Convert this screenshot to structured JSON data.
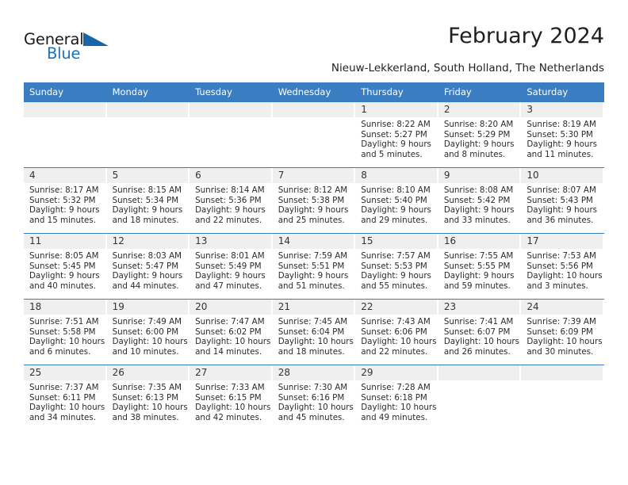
{
  "brand": {
    "name_top": "General",
    "name_bottom": "Blue",
    "accent_color": "#1a74bb",
    "triangle_color": "#1565a8"
  },
  "header": {
    "title": "February 2024",
    "subtitle": "Nieuw-Lekkerland, South Holland, The Netherlands"
  },
  "calendar": {
    "header_bg": "#3a7dc0",
    "daynum_bg": "#efefef",
    "weekday_headers": [
      "Sunday",
      "Monday",
      "Tuesday",
      "Wednesday",
      "Thursday",
      "Friday",
      "Saturday"
    ],
    "weeks": [
      [
        {
          "day": "",
          "sunrise": "",
          "sunset": "",
          "daylight_line1": "",
          "daylight_line2": ""
        },
        {
          "day": "",
          "sunrise": "",
          "sunset": "",
          "daylight_line1": "",
          "daylight_line2": ""
        },
        {
          "day": "",
          "sunrise": "",
          "sunset": "",
          "daylight_line1": "",
          "daylight_line2": ""
        },
        {
          "day": "",
          "sunrise": "",
          "sunset": "",
          "daylight_line1": "",
          "daylight_line2": ""
        },
        {
          "day": "1",
          "sunrise": "Sunrise: 8:22 AM",
          "sunset": "Sunset: 5:27 PM",
          "daylight_line1": "Daylight: 9 hours",
          "daylight_line2": "and 5 minutes."
        },
        {
          "day": "2",
          "sunrise": "Sunrise: 8:20 AM",
          "sunset": "Sunset: 5:29 PM",
          "daylight_line1": "Daylight: 9 hours",
          "daylight_line2": "and 8 minutes."
        },
        {
          "day": "3",
          "sunrise": "Sunrise: 8:19 AM",
          "sunset": "Sunset: 5:30 PM",
          "daylight_line1": "Daylight: 9 hours",
          "daylight_line2": "and 11 minutes."
        }
      ],
      [
        {
          "day": "4",
          "sunrise": "Sunrise: 8:17 AM",
          "sunset": "Sunset: 5:32 PM",
          "daylight_line1": "Daylight: 9 hours",
          "daylight_line2": "and 15 minutes."
        },
        {
          "day": "5",
          "sunrise": "Sunrise: 8:15 AM",
          "sunset": "Sunset: 5:34 PM",
          "daylight_line1": "Daylight: 9 hours",
          "daylight_line2": "and 18 minutes."
        },
        {
          "day": "6",
          "sunrise": "Sunrise: 8:14 AM",
          "sunset": "Sunset: 5:36 PM",
          "daylight_line1": "Daylight: 9 hours",
          "daylight_line2": "and 22 minutes."
        },
        {
          "day": "7",
          "sunrise": "Sunrise: 8:12 AM",
          "sunset": "Sunset: 5:38 PM",
          "daylight_line1": "Daylight: 9 hours",
          "daylight_line2": "and 25 minutes."
        },
        {
          "day": "8",
          "sunrise": "Sunrise: 8:10 AM",
          "sunset": "Sunset: 5:40 PM",
          "daylight_line1": "Daylight: 9 hours",
          "daylight_line2": "and 29 minutes."
        },
        {
          "day": "9",
          "sunrise": "Sunrise: 8:08 AM",
          "sunset": "Sunset: 5:42 PM",
          "daylight_line1": "Daylight: 9 hours",
          "daylight_line2": "and 33 minutes."
        },
        {
          "day": "10",
          "sunrise": "Sunrise: 8:07 AM",
          "sunset": "Sunset: 5:43 PM",
          "daylight_line1": "Daylight: 9 hours",
          "daylight_line2": "and 36 minutes."
        }
      ],
      [
        {
          "day": "11",
          "sunrise": "Sunrise: 8:05 AM",
          "sunset": "Sunset: 5:45 PM",
          "daylight_line1": "Daylight: 9 hours",
          "daylight_line2": "and 40 minutes."
        },
        {
          "day": "12",
          "sunrise": "Sunrise: 8:03 AM",
          "sunset": "Sunset: 5:47 PM",
          "daylight_line1": "Daylight: 9 hours",
          "daylight_line2": "and 44 minutes."
        },
        {
          "day": "13",
          "sunrise": "Sunrise: 8:01 AM",
          "sunset": "Sunset: 5:49 PM",
          "daylight_line1": "Daylight: 9 hours",
          "daylight_line2": "and 47 minutes."
        },
        {
          "day": "14",
          "sunrise": "Sunrise: 7:59 AM",
          "sunset": "Sunset: 5:51 PM",
          "daylight_line1": "Daylight: 9 hours",
          "daylight_line2": "and 51 minutes."
        },
        {
          "day": "15",
          "sunrise": "Sunrise: 7:57 AM",
          "sunset": "Sunset: 5:53 PM",
          "daylight_line1": "Daylight: 9 hours",
          "daylight_line2": "and 55 minutes."
        },
        {
          "day": "16",
          "sunrise": "Sunrise: 7:55 AM",
          "sunset": "Sunset: 5:55 PM",
          "daylight_line1": "Daylight: 9 hours",
          "daylight_line2": "and 59 minutes."
        },
        {
          "day": "17",
          "sunrise": "Sunrise: 7:53 AM",
          "sunset": "Sunset: 5:56 PM",
          "daylight_line1": "Daylight: 10 hours",
          "daylight_line2": "and 3 minutes."
        }
      ],
      [
        {
          "day": "18",
          "sunrise": "Sunrise: 7:51 AM",
          "sunset": "Sunset: 5:58 PM",
          "daylight_line1": "Daylight: 10 hours",
          "daylight_line2": "and 6 minutes."
        },
        {
          "day": "19",
          "sunrise": "Sunrise: 7:49 AM",
          "sunset": "Sunset: 6:00 PM",
          "daylight_line1": "Daylight: 10 hours",
          "daylight_line2": "and 10 minutes."
        },
        {
          "day": "20",
          "sunrise": "Sunrise: 7:47 AM",
          "sunset": "Sunset: 6:02 PM",
          "daylight_line1": "Daylight: 10 hours",
          "daylight_line2": "and 14 minutes."
        },
        {
          "day": "21",
          "sunrise": "Sunrise: 7:45 AM",
          "sunset": "Sunset: 6:04 PM",
          "daylight_line1": "Daylight: 10 hours",
          "daylight_line2": "and 18 minutes."
        },
        {
          "day": "22",
          "sunrise": "Sunrise: 7:43 AM",
          "sunset": "Sunset: 6:06 PM",
          "daylight_line1": "Daylight: 10 hours",
          "daylight_line2": "and 22 minutes."
        },
        {
          "day": "23",
          "sunrise": "Sunrise: 7:41 AM",
          "sunset": "Sunset: 6:07 PM",
          "daylight_line1": "Daylight: 10 hours",
          "daylight_line2": "and 26 minutes."
        },
        {
          "day": "24",
          "sunrise": "Sunrise: 7:39 AM",
          "sunset": "Sunset: 6:09 PM",
          "daylight_line1": "Daylight: 10 hours",
          "daylight_line2": "and 30 minutes."
        }
      ],
      [
        {
          "day": "25",
          "sunrise": "Sunrise: 7:37 AM",
          "sunset": "Sunset: 6:11 PM",
          "daylight_line1": "Daylight: 10 hours",
          "daylight_line2": "and 34 minutes."
        },
        {
          "day": "26",
          "sunrise": "Sunrise: 7:35 AM",
          "sunset": "Sunset: 6:13 PM",
          "daylight_line1": "Daylight: 10 hours",
          "daylight_line2": "and 38 minutes."
        },
        {
          "day": "27",
          "sunrise": "Sunrise: 7:33 AM",
          "sunset": "Sunset: 6:15 PM",
          "daylight_line1": "Daylight: 10 hours",
          "daylight_line2": "and 42 minutes."
        },
        {
          "day": "28",
          "sunrise": "Sunrise: 7:30 AM",
          "sunset": "Sunset: 6:16 PM",
          "daylight_line1": "Daylight: 10 hours",
          "daylight_line2": "and 45 minutes."
        },
        {
          "day": "29",
          "sunrise": "Sunrise: 7:28 AM",
          "sunset": "Sunset: 6:18 PM",
          "daylight_line1": "Daylight: 10 hours",
          "daylight_line2": "and 49 minutes."
        },
        {
          "day": "",
          "sunrise": "",
          "sunset": "",
          "daylight_line1": "",
          "daylight_line2": ""
        },
        {
          "day": "",
          "sunrise": "",
          "sunset": "",
          "daylight_line1": "",
          "daylight_line2": ""
        }
      ]
    ]
  }
}
